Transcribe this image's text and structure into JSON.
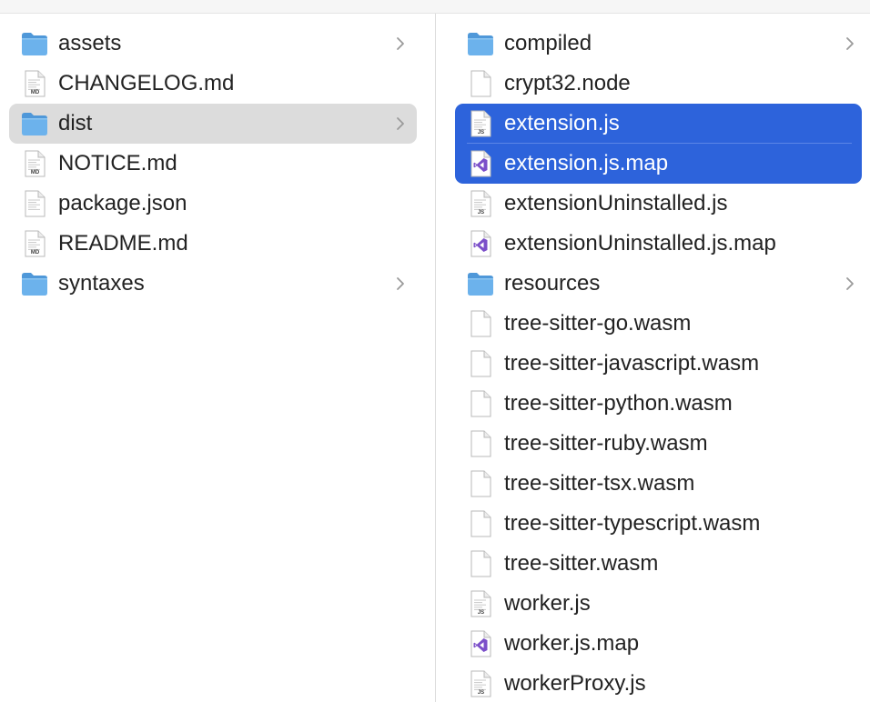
{
  "left_column": {
    "items": [
      {
        "name": "assets",
        "type": "folder",
        "has_children": true,
        "selected": ""
      },
      {
        "name": "CHANGELOG.md",
        "type": "md",
        "has_children": false,
        "selected": ""
      },
      {
        "name": "dist",
        "type": "folder",
        "has_children": true,
        "selected": "inactive"
      },
      {
        "name": "NOTICE.md",
        "type": "md",
        "has_children": false,
        "selected": ""
      },
      {
        "name": "package.json",
        "type": "doc",
        "has_children": false,
        "selected": ""
      },
      {
        "name": "README.md",
        "type": "md",
        "has_children": false,
        "selected": ""
      },
      {
        "name": "syntaxes",
        "type": "folder",
        "has_children": true,
        "selected": ""
      }
    ]
  },
  "right_column": {
    "items": [
      {
        "name": "compiled",
        "type": "folder",
        "has_children": true,
        "selected": ""
      },
      {
        "name": "crypt32.node",
        "type": "blank",
        "has_children": false,
        "selected": ""
      },
      {
        "name": "extension.js",
        "type": "js",
        "has_children": false,
        "selected": "active"
      },
      {
        "name": "extension.js.map",
        "type": "vs",
        "has_children": false,
        "selected": "active"
      },
      {
        "name": "extensionUninstalled.js",
        "type": "js",
        "has_children": false,
        "selected": ""
      },
      {
        "name": "extensionUninstalled.js.map",
        "type": "vs",
        "has_children": false,
        "selected": ""
      },
      {
        "name": "resources",
        "type": "folder",
        "has_children": true,
        "selected": ""
      },
      {
        "name": "tree-sitter-go.wasm",
        "type": "blank",
        "has_children": false,
        "selected": ""
      },
      {
        "name": "tree-sitter-javascript.wasm",
        "type": "blank",
        "has_children": false,
        "selected": ""
      },
      {
        "name": "tree-sitter-python.wasm",
        "type": "blank",
        "has_children": false,
        "selected": ""
      },
      {
        "name": "tree-sitter-ruby.wasm",
        "type": "blank",
        "has_children": false,
        "selected": ""
      },
      {
        "name": "tree-sitter-tsx.wasm",
        "type": "blank",
        "has_children": false,
        "selected": ""
      },
      {
        "name": "tree-sitter-typescript.wasm",
        "type": "blank",
        "has_children": false,
        "selected": ""
      },
      {
        "name": "tree-sitter.wasm",
        "type": "blank",
        "has_children": false,
        "selected": ""
      },
      {
        "name": "worker.js",
        "type": "js",
        "has_children": false,
        "selected": ""
      },
      {
        "name": "worker.js.map",
        "type": "vs",
        "has_children": false,
        "selected": ""
      },
      {
        "name": "workerProxy.js",
        "type": "js",
        "has_children": false,
        "selected": ""
      }
    ]
  },
  "icon_badges": {
    "md": "MD",
    "js": "JS"
  },
  "colors": {
    "selection_active": "#2d63db",
    "selection_inactive": "#dcdcdc",
    "folder": "#5fa8e6",
    "vs_purple": "#7b4fc9"
  }
}
